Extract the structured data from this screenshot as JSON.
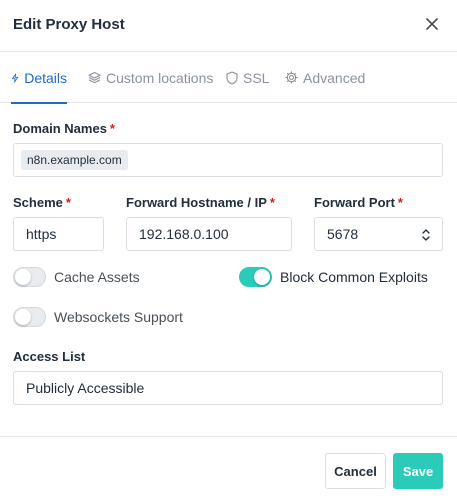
{
  "modal": {
    "title": "Edit Proxy Host"
  },
  "tabs": [
    {
      "label": "Details",
      "icon": "bolt-icon",
      "active": true
    },
    {
      "label": "Custom locations",
      "icon": "layers-icon",
      "active": false
    },
    {
      "label": "SSL",
      "icon": "shield-icon",
      "active": false
    },
    {
      "label": "Advanced",
      "icon": "gear-icon",
      "active": false
    }
  ],
  "form": {
    "domain_names": {
      "label": "Domain Names",
      "required_mark": "*",
      "chip": "n8n.example.com"
    },
    "scheme": {
      "label": "Scheme",
      "required_mark": "*",
      "value": "https"
    },
    "forward_hostname": {
      "label": "Forward Hostname / IP",
      "required_mark": "*",
      "value": "192.168.0.100"
    },
    "forward_port": {
      "label": "Forward Port",
      "required_mark": "*",
      "value": "5678"
    },
    "toggles": {
      "cache_assets": {
        "label": "Cache Assets",
        "on": false
      },
      "block_common_exploits": {
        "label": "Block Common Exploits",
        "on": true
      },
      "websockets_support": {
        "label": "Websockets Support",
        "on": false
      }
    },
    "access_list": {
      "label": "Access List",
      "value": "Publicly Accessible"
    }
  },
  "footer": {
    "cancel_label": "Cancel",
    "save_label": "Save"
  },
  "colors": {
    "accent": "#206bc4",
    "teal": "#2bcbba",
    "required": "#cd201f"
  }
}
